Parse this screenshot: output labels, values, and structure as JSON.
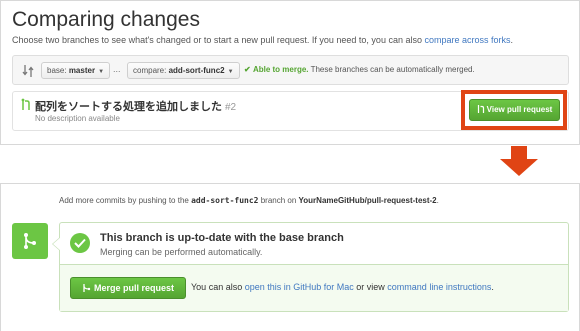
{
  "header": {
    "title": "Comparing changes",
    "subtitle_prefix": "Choose two branches to see what's changed or to start a new pull request. If you need to, you can also ",
    "subtitle_link": "compare across forks",
    "subtitle_suffix": "."
  },
  "range": {
    "base_label": "base:",
    "base_value": "master",
    "dots": "...",
    "compare_label": "compare:",
    "compare_value": "add-sort-func2",
    "status_ok": "Able to merge.",
    "status_text": "These branches can be automatically merged."
  },
  "pull_request": {
    "title": "配列をソートする処理を追加しました",
    "number": "#2",
    "description": "No description available",
    "view_button": "View pull request"
  },
  "merge": {
    "hint_prefix": "Add more commits by pushing to the ",
    "hint_branch": "add-sort-func2",
    "hint_middle": " branch on ",
    "hint_repo": "YourNameGitHub/pull-request-test-2",
    "hint_suffix": ".",
    "status_heading": "This branch is up-to-date with the base branch",
    "status_sub": "Merging can be performed automatically.",
    "merge_button": "Merge pull request",
    "alt_prefix": "You can also ",
    "alt_link_desktop": "open this in GitHub for Mac",
    "alt_middle": " or view ",
    "alt_link_cli": "command line instructions",
    "alt_suffix": "."
  },
  "colors": {
    "accent_green": "#6cc644",
    "link_blue": "#4078c0",
    "highlight_red": "#e04414"
  }
}
